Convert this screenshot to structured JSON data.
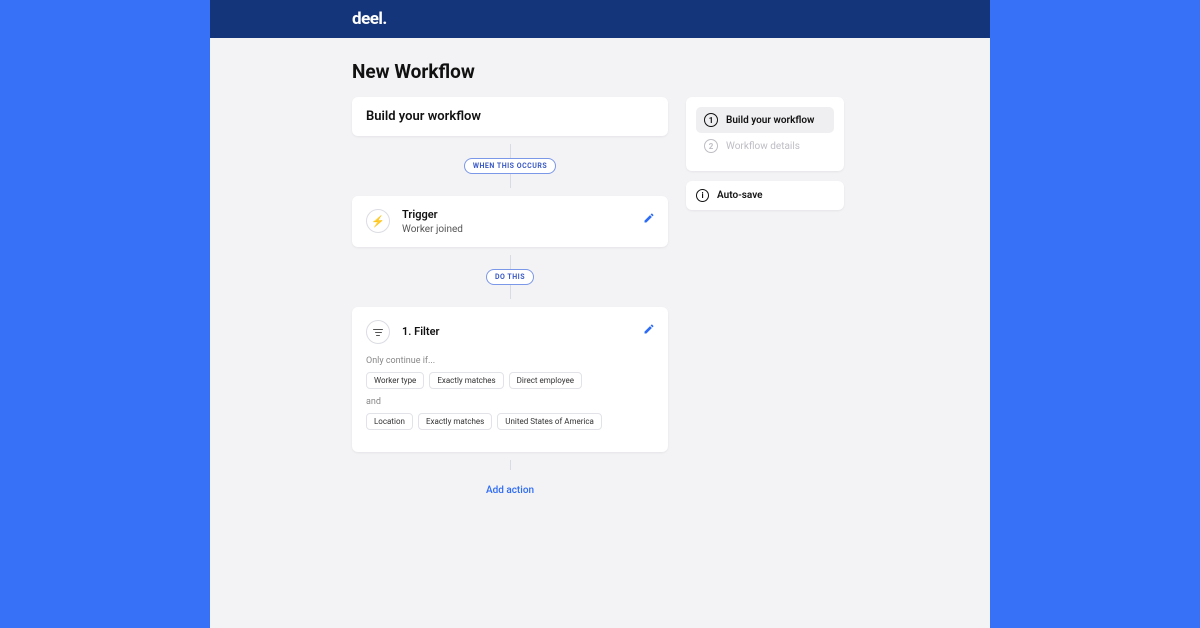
{
  "brand": "deel.",
  "page_title": "New Workflow",
  "build_header": "Build your workflow",
  "connectors": {
    "when_occurs": "WHEN THIS OCCURS",
    "do_this": "DO THIS"
  },
  "trigger": {
    "title": "Trigger",
    "subtitle": "Worker joined"
  },
  "filter": {
    "title": "1.  Filter",
    "only_continue": "Only continue if...",
    "and": "and",
    "cond1": {
      "field": "Worker type",
      "op": "Exactly matches",
      "value": "Direct employee"
    },
    "cond2": {
      "field": "Location",
      "op": "Exactly matches",
      "value": "United States of America"
    }
  },
  "add_action": "Add action",
  "sidebar": {
    "step1": "Build your workflow",
    "step2": "Workflow details",
    "num1": "1",
    "num2": "2"
  },
  "autosave": "Auto-save"
}
